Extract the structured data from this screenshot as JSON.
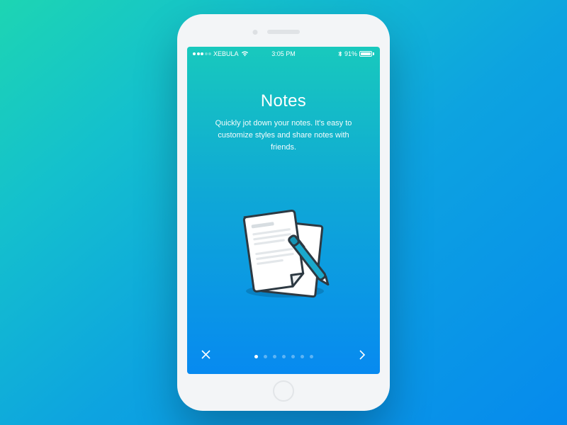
{
  "statusbar": {
    "carrier": "XEBULA",
    "time": "3:05 PM",
    "battery_text": "91%"
  },
  "page": {
    "title": "Notes",
    "description": "Quickly jot down your notes. It's easy to customize styles and share notes with friends."
  },
  "pager": {
    "count": 7,
    "active": 0
  },
  "icons": {
    "close": "close-icon",
    "next": "chevron-right-icon",
    "paper_pen": "paper-pen-icon",
    "wifi": "wifi-icon",
    "bluetooth": "bluetooth-icon",
    "signal": "signal-dots-icon",
    "battery": "battery-icon"
  }
}
